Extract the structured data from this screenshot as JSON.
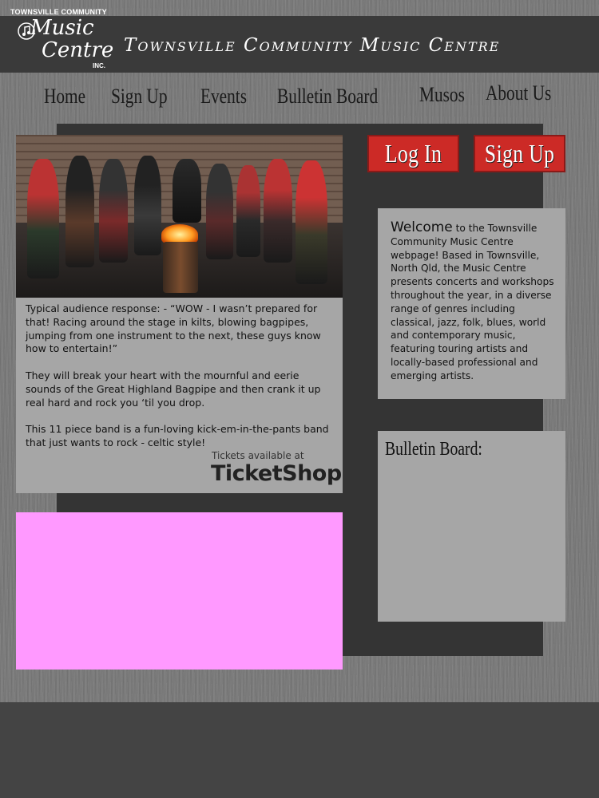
{
  "header": {
    "logo_top": "TOWNSVILLE COMMUNITY",
    "logo_line1": "Music",
    "logo_line2": "Centre",
    "logo_inc": "INC.",
    "site_title": "Townsville Community Music Centre"
  },
  "nav": {
    "items": [
      {
        "label": "Home"
      },
      {
        "label": "Sign Up"
      },
      {
        "label": "Events"
      },
      {
        "label": "Bulletin Board"
      },
      {
        "label": "Musos"
      },
      {
        "label": "About Us"
      }
    ]
  },
  "article": {
    "paragraph1": "Typical audience response: - “WOW - I wasn’t prepared for that! Racing around the stage in kilts, blowing bagpipes, jumping from one instrument to the next, these guys know how to entertain!”",
    "paragraph2": "They will break your heart with the mournful and eerie sounds of the Great Highland Bagpipe and then crank it up real hard and rock you ‘til you drop.",
    "paragraph3": "This 11 piece band is a fun-loving kick-em-in-the-pants band that just wants to rock - celtic style!",
    "tickets_label": "Tickets available at",
    "ticketshop_logo": "TicketShop"
  },
  "auth": {
    "login_label": "Log In",
    "signup_label": "Sign Up"
  },
  "welcome": {
    "first_word": "Welcome",
    "rest": " to the Townsville Community Music Centre webpage! Based in Townsville, North Qld, the Music Centre presents concerts and workshops throughout the year, in a diverse range of genres including classical, jazz, folk, blues, world and contemporary music, featuring touring artists and locally-based professional and emerging artists."
  },
  "bulletin": {
    "title": "Bulletin Board:"
  },
  "colors": {
    "button_red": "#cc2a26",
    "panel_gray": "#a6a6a6",
    "placeholder_pink": "#ff99ff"
  }
}
